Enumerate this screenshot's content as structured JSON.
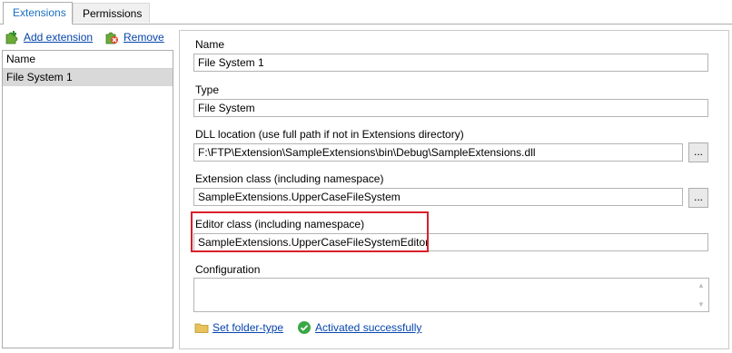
{
  "tabs": [
    {
      "label": "Extensions",
      "active": true
    },
    {
      "label": "Permissions",
      "active": false
    }
  ],
  "toolbar": {
    "add_label": "Add extension",
    "remove_label": "Remove"
  },
  "list": {
    "header": "Name",
    "items": [
      "File System 1"
    ]
  },
  "form": {
    "name_label": "Name",
    "name_value": "File System 1",
    "type_label": "Type",
    "type_value": "File System",
    "dll_label": "DLL location (use full path if not in Extensions directory)",
    "dll_value": "F:\\FTP\\Extension\\SampleExtensions\\bin\\Debug\\SampleExtensions.dll",
    "extclass_label": "Extension class (including namespace)",
    "extclass_value": "SampleExtensions.UpperCaseFileSystem",
    "editor_label": "Editor class (including namespace)",
    "editor_value": "SampleExtensions.UpperCaseFileSystemEditor",
    "config_label": "Configuration",
    "config_value": "",
    "browse_label": "..."
  },
  "footer": {
    "set_folder_label": "Set folder-type",
    "status_label": "Activated successfully"
  },
  "colors": {
    "tab_active_text": "#1a6fc1",
    "link": "#0645ad",
    "highlight_border": "#d8202a",
    "selected_row": "#d9d9d9"
  }
}
